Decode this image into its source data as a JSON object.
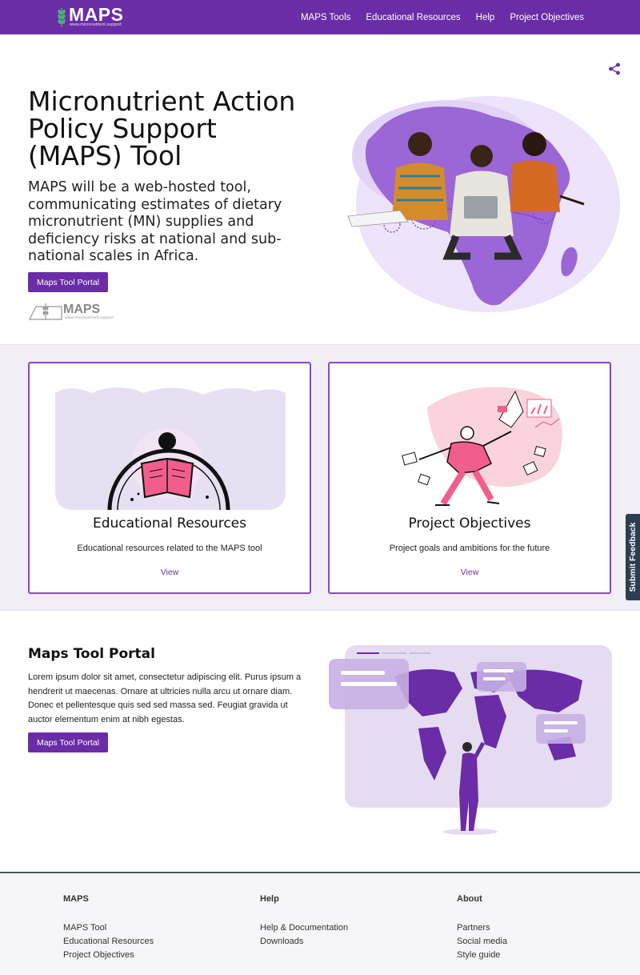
{
  "nav": {
    "logo_text": "MAPS",
    "logo_url": "www.micronutrient.support",
    "links": [
      "MAPS Tools",
      "Educational Resources",
      "Help",
      "Project Objectives"
    ]
  },
  "hero": {
    "title": "Micronutrient Action Policy Support (MAPS) Tool",
    "subtitle": "MAPS will be a web-hosted tool, communicating estimates of dietary micronutrient (MN) supplies and deficiency risks at national and sub-national scales in Africa.",
    "button_label": "Maps Tool Portal",
    "secondary_logo_text": "MAPS",
    "secondary_logo_url": "www.micronutrient.support"
  },
  "cards": [
    {
      "title": "Educational Resources",
      "description": "Educational resources related to the MAPS tool",
      "link": "View"
    },
    {
      "title": "Project Objectives",
      "description": "Project goals and ambitions for the future",
      "link": "View"
    }
  ],
  "feedback": {
    "label": "Submit Feedback"
  },
  "portal": {
    "title": "Maps Tool Portal",
    "text": "Lorem ipsum dolor sit amet, consectetur adipiscing elit. Purus ipsum a hendrerit ut maecenas. Ornare at ultricies nulla arcu ut ornare diam. Donec et pellentesque quis sed sed massa sed. Feugiat gravida ut auctor elementum enim at nibh egestas.",
    "button_label": "Maps Tool Portal"
  },
  "footer": {
    "columns": [
      {
        "heading": "MAPS",
        "links": [
          "MAPS Tool",
          "Educational Resources",
          "Project Objectives"
        ]
      },
      {
        "heading": "Help",
        "links": [
          "Help & Documentation",
          "Downloads"
        ]
      },
      {
        "heading": "About",
        "links": [
          "Partners",
          "Social media",
          "Style guide"
        ]
      }
    ]
  },
  "colors": {
    "brand": "#6a2ca7",
    "accent_light": "#f1eef7",
    "feedback_tab": "#2c3e50"
  },
  "icons": [
    "wheat-logo-icon",
    "share-icon"
  ]
}
